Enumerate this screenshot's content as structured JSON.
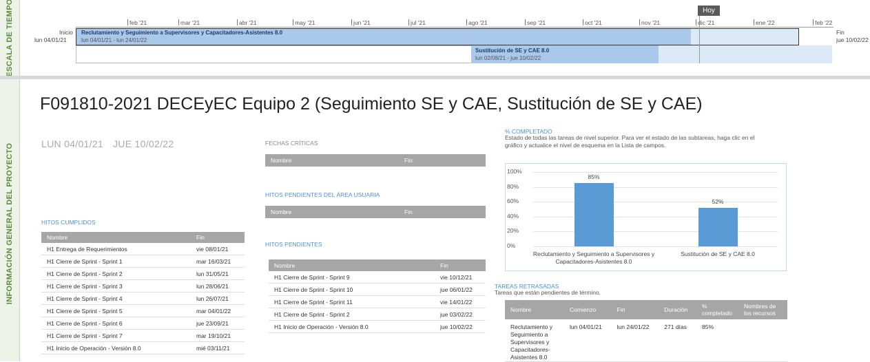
{
  "timeline": {
    "vertical_label": "ESCALA DE TIEMPO",
    "today_label": "Hoy",
    "months": [
      "feb '21",
      "mar '21",
      "abr '21",
      "may '21",
      "jun '21",
      "jul '21",
      "ago '21",
      "sep '21",
      "oct '21",
      "nov '21",
      "dic '21",
      "ene '22",
      "feb '22"
    ],
    "start": {
      "label": "Inicio",
      "date": "lun 04/01/21"
    },
    "end": {
      "label": "Fin",
      "date": "jue 10/02/22"
    },
    "bars": [
      {
        "title": "Reclutamiento y Seguimiento a Supervisores y Capacitadores-Asistentes 8.0",
        "dates": "lun 04/01/21 - lun 24/01/22"
      },
      {
        "title": "Sustitución de SE y CAE 8.0",
        "dates": "lun 02/08/21 - jue 10/02/22"
      }
    ],
    "colors": {
      "bar_fill": "#a9c8ea",
      "bar_light": "#dce9f6"
    }
  },
  "info": {
    "vertical_label": "INFORMACIÓN GENERAL DEL PROYECTO",
    "title": "F091810-2021 DECEyEC Equipo 2 (Seguimiento SE y CAE, Sustitución de SE y CAE)",
    "start_date": "LUN 04/01/21",
    "end_date": "JUE 10/02/22"
  },
  "hitos_cumplidos": {
    "label": "HITOS CUMPLIDOS",
    "headers": [
      "Nombre",
      "Fin"
    ],
    "rows": [
      [
        "H1 Entrega de Requerimientos",
        "vie 08/01/21"
      ],
      [
        "H1 Cierre de Sprint - Sprint 1",
        "mar 16/03/21"
      ],
      [
        "H1 Cierre de Sprint - Sprint 2",
        "lun 31/05/21"
      ],
      [
        "H1 Cierre de Sprint - Sprint 3",
        "lun 28/06/21"
      ],
      [
        "H1 Cierre de Sprint - Sprint 4",
        "lun 26/07/21"
      ],
      [
        "H1 Cierre de Sprint - Sprint 5",
        "mar 04/01/22"
      ],
      [
        "H1 Cierre de Sprint - Sprint 6",
        "jue 23/09/21"
      ],
      [
        "H1 Cierre de Sprint - Sprint 7",
        "mar 19/10/21"
      ],
      [
        "H1 Inicio de Operación - Versión 8.0",
        "mié 03/11/21"
      ]
    ]
  },
  "fechas_criticas": {
    "label": "FECHAS CRÍTICAS",
    "headers": [
      "Nombre",
      "Fin"
    ]
  },
  "hitos_area": {
    "label": "HITOS PENDIENTES DEL ÁREA USUARIA",
    "headers": [
      "Nombre",
      "Fin"
    ]
  },
  "hitos_pendientes": {
    "label": "HITOS PENDIENTES",
    "headers": [
      "Nombre",
      "Fin"
    ],
    "rows": [
      [
        "H1 Cierre de Sprint - Sprint 9",
        "vie 10/12/21"
      ],
      [
        "H1 Cierre de Sprint - Sprint 10",
        "jue 06/01/22"
      ],
      [
        "H1 Cierre de Sprint - Sprint 11",
        "vie 14/01/22"
      ],
      [
        "H1 Cierre de Sprint - Sprint 2",
        "jue 03/02/22"
      ],
      [
        "H1 Inicio de Operación - Versión 8.0",
        "jue 10/02/22"
      ]
    ]
  },
  "completado": {
    "label": "% COMPLETADO",
    "desc": "Estado de todas las tareas de nivel superior. Para ver el estado de las subtareas, haga clic en el gráfico y actualice el nivel de esquema en la Lista de campos."
  },
  "chart_data": {
    "type": "bar",
    "categories": [
      "Reclutamiento y Seguimiento a Supervisores y Capacitadores-Asistentes 8.0",
      "Sustitución de SE y CAE 8.0"
    ],
    "values": [
      85,
      52
    ],
    "data_labels": [
      "85%",
      "52%"
    ],
    "yticks": [
      "0%",
      "20%",
      "40%",
      "60%",
      "80%",
      "100%"
    ],
    "ylim": [
      0,
      100
    ],
    "color": "#5b9bd5",
    "grid": true
  },
  "tareas_retrasadas": {
    "label": "TAREAS RETRASADAS",
    "desc": "Tareas que están pendientes de término.",
    "headers": [
      "Nombre",
      "Comienzo",
      "Fin",
      "Duración",
      "% completado",
      "Nombres de los recursos"
    ],
    "rows": [
      [
        "Reclutamiento y Seguimiento a Supervisores y Capacitadores-Asistentes 8.0",
        "lun 04/01/21",
        "lun 24/01/22",
        "271 días",
        "85%",
        ""
      ]
    ]
  }
}
